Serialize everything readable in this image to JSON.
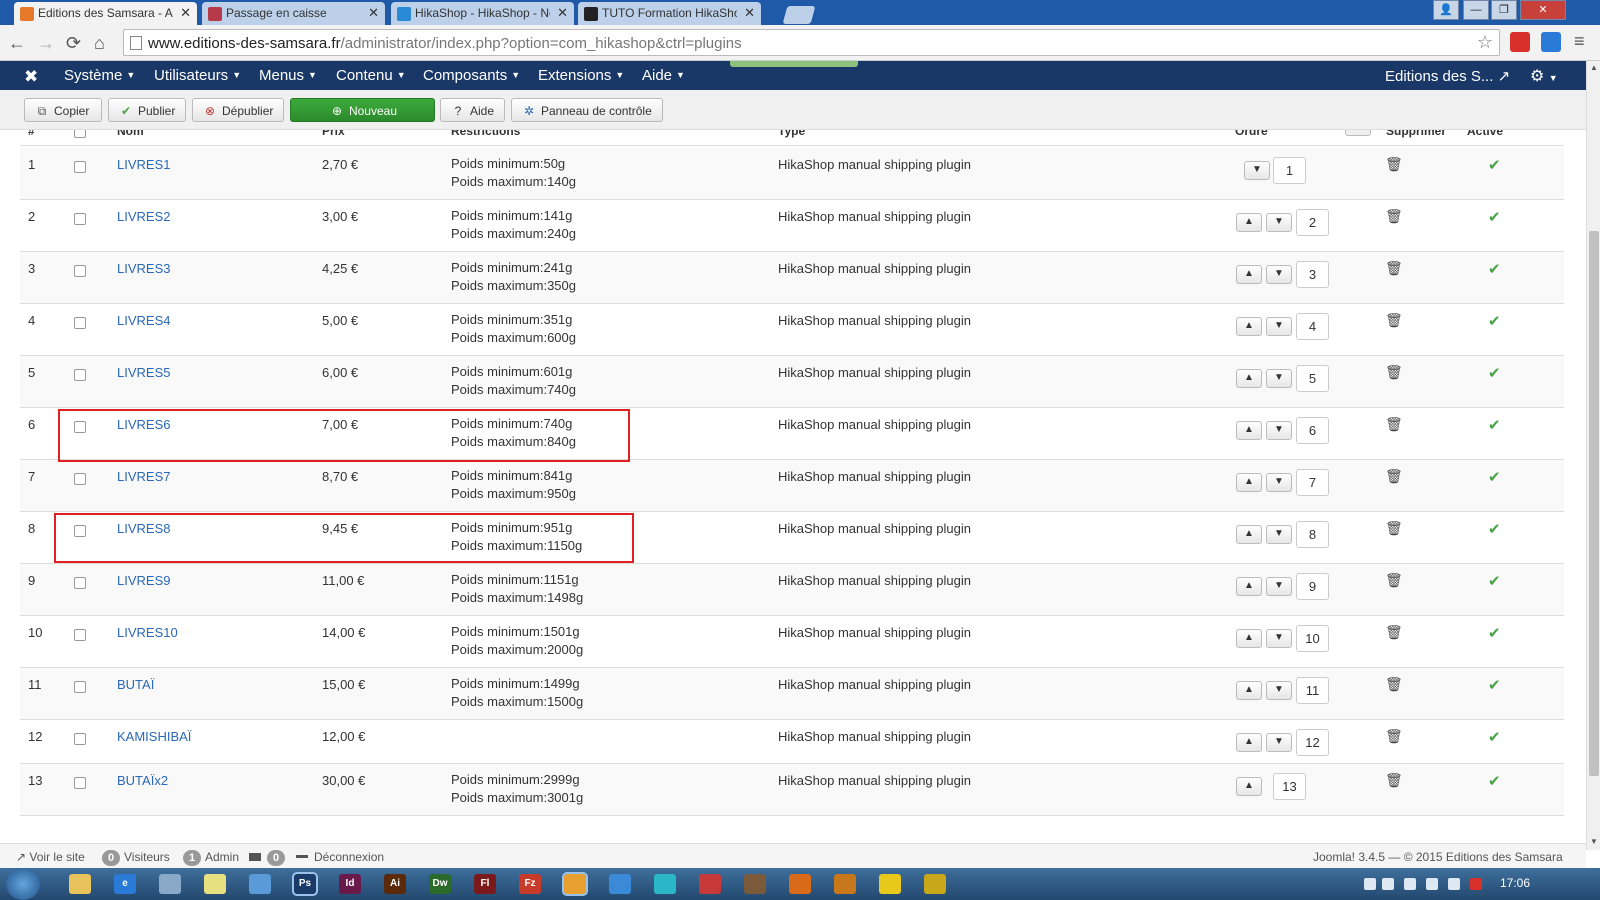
{
  "browser": {
    "tabs": [
      {
        "title": "Editions des Samsara - Ad",
        "active": true,
        "favicon_color": "#e8782a"
      },
      {
        "title": "Passage en caisse",
        "active": false,
        "favicon_color": "#b63a4a"
      },
      {
        "title": "HikaShop - HikaShop - Ne",
        "active": false,
        "favicon_color": "#2a8ad8"
      },
      {
        "title": "TUTO Formation HikaShop",
        "active": false,
        "favicon_color": "#222222"
      }
    ],
    "close_glyph": "✕",
    "window_buttons": [
      "👤",
      "—",
      "❐",
      "✕"
    ],
    "url_host": "www.editions-des-samsara.fr",
    "url_path": "/administrator/index.php?option=com_hikashop&ctrl=plugins",
    "nav": {
      "back": "←",
      "forward": "→",
      "reload": "⟳",
      "home": "⌂",
      "star": "☆",
      "menu": "≡"
    }
  },
  "admin_nav": {
    "logo_glyph": "✖",
    "menus": [
      "Système",
      "Utilisateurs",
      "Menus",
      "Contenu",
      "Composants",
      "Extensions",
      "Aide"
    ],
    "site_name": "Editions des S...",
    "site_glyph": "↗",
    "gear_glyph": "⚙",
    "caret": "▼"
  },
  "toolbar": {
    "buttons": [
      {
        "label": "Copier",
        "icon": "⧉"
      },
      {
        "label": "Publier",
        "icon": "✔"
      },
      {
        "label": "Dépublier",
        "icon": "⊗"
      },
      {
        "label": "Nouveau",
        "icon": "⊕"
      },
      {
        "label": "Aide",
        "icon": "?"
      },
      {
        "label": "Panneau de contrôle",
        "icon": "✲"
      }
    ]
  },
  "table": {
    "headers": {
      "num": "#",
      "name": "Nom",
      "price": "Prix",
      "restrictions": "Restrictions",
      "type": "Type",
      "order": "Ordre",
      "delete": "Supprimer",
      "active": "Activé"
    },
    "up_glyph": "▲",
    "down_glyph": "▼",
    "trash_glyph": "🗑",
    "check_glyph": "✔",
    "rows": [
      {
        "num": "1",
        "name": "LIVRES1",
        "price": "2,70 €",
        "min": "Poids minimum:50g",
        "max": "Poids maximum:140g",
        "type": "HikaShop manual shipping plugin",
        "order": "1",
        "up": false,
        "down": true
      },
      {
        "num": "2",
        "name": "LIVRES2",
        "price": "3,00 €",
        "min": "Poids minimum:141g",
        "max": "Poids maximum:240g",
        "type": "HikaShop manual shipping plugin",
        "order": "2",
        "up": true,
        "down": true
      },
      {
        "num": "3",
        "name": "LIVRES3",
        "price": "4,25 €",
        "min": "Poids minimum:241g",
        "max": "Poids maximum:350g",
        "type": "HikaShop manual shipping plugin",
        "order": "3",
        "up": true,
        "down": true
      },
      {
        "num": "4",
        "name": "LIVRES4",
        "price": "5,00 €",
        "min": "Poids minimum:351g",
        "max": "Poids maximum:600g",
        "type": "HikaShop manual shipping plugin",
        "order": "4",
        "up": true,
        "down": true
      },
      {
        "num": "5",
        "name": "LIVRES5",
        "price": "6,00 €",
        "min": "Poids minimum:601g",
        "max": "Poids maximum:740g",
        "type": "HikaShop manual shipping plugin",
        "order": "5",
        "up": true,
        "down": true
      },
      {
        "num": "6",
        "name": "LIVRES6",
        "price": "7,00 €",
        "min": "Poids minimum:740g",
        "max": "Poids maximum:840g",
        "type": "HikaShop manual shipping plugin",
        "order": "6",
        "up": true,
        "down": true
      },
      {
        "num": "7",
        "name": "LIVRES7",
        "price": "8,70 €",
        "min": "Poids minimum:841g",
        "max": "Poids maximum:950g",
        "type": "HikaShop manual shipping plugin",
        "order": "7",
        "up": true,
        "down": true
      },
      {
        "num": "8",
        "name": "LIVRES8",
        "price": "9,45 €",
        "min": "Poids minimum:951g",
        "max": "Poids maximum:1150g",
        "type": "HikaShop manual shipping plugin",
        "order": "8",
        "up": true,
        "down": true
      },
      {
        "num": "9",
        "name": "LIVRES9",
        "price": "11,00 €",
        "min": "Poids minimum:1151g",
        "max": "Poids maximum:1498g",
        "type": "HikaShop manual shipping plugin",
        "order": "9",
        "up": true,
        "down": true
      },
      {
        "num": "10",
        "name": "LIVRES10",
        "price": "14,00 €",
        "min": "Poids minimum:1501g",
        "max": "Poids maximum:2000g",
        "type": "HikaShop manual shipping plugin",
        "order": "10",
        "up": true,
        "down": true
      },
      {
        "num": "11",
        "name": "BUTAÏ",
        "price": "15,00 €",
        "min": "Poids minimum:1499g",
        "max": "Poids maximum:1500g",
        "type": "HikaShop manual shipping plugin",
        "order": "11",
        "up": true,
        "down": true
      },
      {
        "num": "12",
        "name": "KAMISHIBAÏ",
        "price": "12,00 €",
        "min": "",
        "max": "",
        "type": "HikaShop manual shipping plugin",
        "order": "12",
        "up": true,
        "down": true
      },
      {
        "num": "13",
        "name": "BUTAÏx2",
        "price": "30,00 €",
        "min": "Poids minimum:2999g",
        "max": "Poids maximum:3001g",
        "type": "HikaShop manual shipping plugin",
        "order": "13",
        "up": true,
        "down": false
      }
    ]
  },
  "footer": {
    "view_site": "Voir le site",
    "visitors_count": "0",
    "visitors_label": "Visiteurs",
    "admin_count": "1",
    "admin_label": "Admin",
    "messages_count": "0",
    "logout": "Déconnexion",
    "version": "Joomla! 3.4.5 — © 2015 Editions des Samsara"
  },
  "taskbar": {
    "apps": [
      {
        "label": "",
        "color": "#e8c25a"
      },
      {
        "label": "e",
        "color": "#2a7ad8"
      },
      {
        "label": "",
        "color": "#8aa8c8"
      },
      {
        "label": "",
        "color": "#e8e080"
      },
      {
        "label": "",
        "color": "#5a9ad8"
      },
      {
        "label": "Ps",
        "color": "#1a3a6a"
      },
      {
        "label": "Id",
        "color": "#6a1a4a"
      },
      {
        "label": "Ai",
        "color": "#5a2a0a"
      },
      {
        "label": "Dw",
        "color": "#2a6a2a"
      },
      {
        "label": "Fl",
        "color": "#7a1a1a"
      },
      {
        "label": "Fz",
        "color": "#c83a2a"
      },
      {
        "label": "",
        "color": "#e8a030"
      },
      {
        "label": "",
        "color": "#3a8ad8"
      },
      {
        "label": "",
        "color": "#2ab8c8"
      },
      {
        "label": "",
        "color": "#c83a3a"
      },
      {
        "label": "",
        "color": "#7a5a3a"
      },
      {
        "label": "",
        "color": "#d86a1a"
      },
      {
        "label": "",
        "color": "#c8781a"
      },
      {
        "label": "",
        "color": "#e8c81a"
      },
      {
        "label": "",
        "color": "#c8a81a"
      }
    ],
    "clock": "17:06"
  }
}
